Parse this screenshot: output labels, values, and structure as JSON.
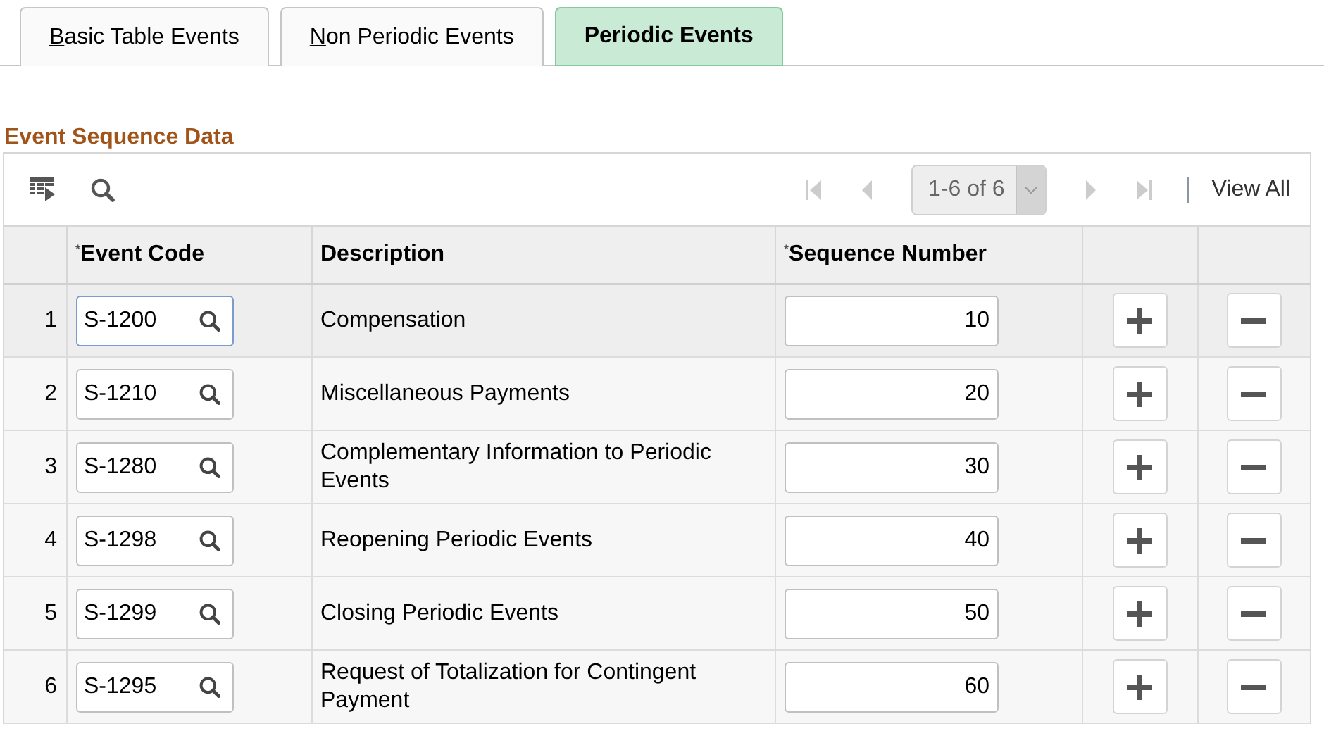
{
  "tabs": [
    {
      "label": "Basic Table Events",
      "underline_first": true,
      "selected": false
    },
    {
      "label": "Non Periodic Events",
      "underline_first": true,
      "selected": false
    },
    {
      "label": "Periodic Events",
      "selected": true
    }
  ],
  "grid": {
    "title": "Event Sequence Data",
    "pager": {
      "range": "1-6 of 6",
      "view_all": "View All"
    },
    "columns": [
      {
        "label": "Event Code",
        "required_mark": "*"
      },
      {
        "label": "Description"
      },
      {
        "label": "Sequence Number",
        "required_mark": "*"
      }
    ],
    "rows": [
      {
        "number": "1",
        "event_code": "S-1200",
        "description": "Compensation",
        "sequence": "10",
        "selected": true
      },
      {
        "number": "2",
        "event_code": "S-1210",
        "description": "Miscellaneous Payments",
        "sequence": "20",
        "selected": false
      },
      {
        "number": "3",
        "event_code": "S-1280",
        "description": "Complementary Information to Periodic Events",
        "sequence": "30",
        "selected": false
      },
      {
        "number": "4",
        "event_code": "S-1298",
        "description": "Reopening Periodic Events",
        "sequence": "40",
        "selected": false
      },
      {
        "number": "5",
        "event_code": "S-1299",
        "description": "Closing Periodic Events",
        "sequence": "50",
        "selected": false
      },
      {
        "number": "6",
        "event_code": "S-1295",
        "description": "Request of Totalization for Contingent Payment",
        "sequence": "60",
        "selected": false
      }
    ]
  }
}
